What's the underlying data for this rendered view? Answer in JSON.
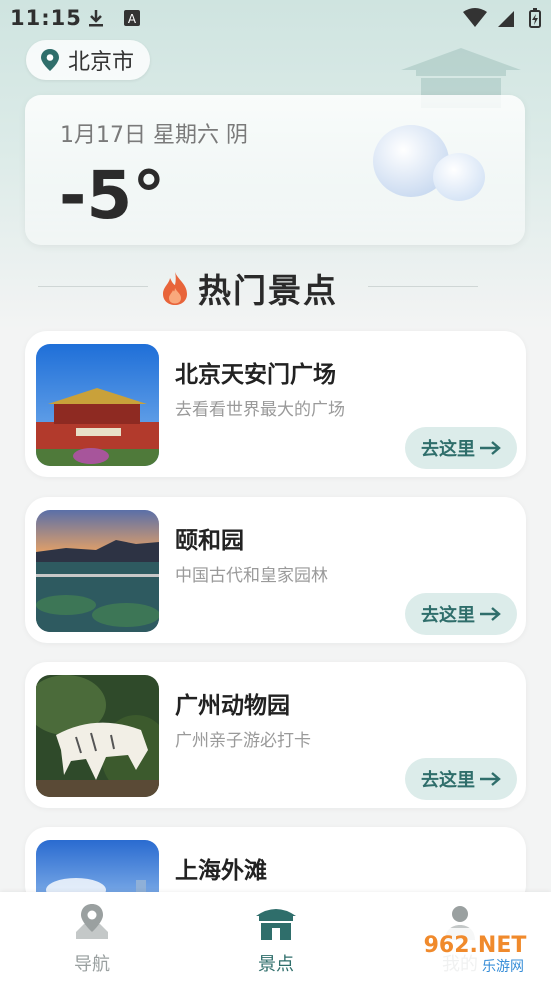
{
  "status_bar": {
    "time": "11:15",
    "left_icons": [
      "download-icon",
      "a-badge-icon"
    ],
    "right_icons": [
      "wifi-icon",
      "signal-icon",
      "battery-icon"
    ]
  },
  "location": {
    "city": "北京市",
    "icon": "location-pin-icon"
  },
  "weather": {
    "date_text": "1月17日 星期六 阴",
    "temperature": "-5°",
    "icon": "cloud-icon"
  },
  "section": {
    "title": "热门景点",
    "icon": "fire-icon",
    "accent": "#e8643a"
  },
  "spots": [
    {
      "name": "北京天安门广场",
      "desc": "去看看世界最大的广场",
      "button": "去这里"
    },
    {
      "name": "颐和园",
      "desc": "中国古代和皇家园林",
      "button": "去这里"
    },
    {
      "name": "广州动物园",
      "desc": "广州亲子游必打卡",
      "button": "去这里"
    },
    {
      "name": "上海外滩",
      "desc": "",
      "button": ""
    }
  ],
  "tabs": [
    {
      "label": "导航",
      "icon": "map-pin-icon",
      "active": false
    },
    {
      "label": "景点",
      "icon": "pavilion-icon",
      "active": true
    },
    {
      "label": "我的",
      "icon": "user-icon",
      "active": false
    }
  ],
  "colors": {
    "primary": "#2f6e6b",
    "button_bg": "#dcecea",
    "inactive": "#9aa0a0"
  },
  "watermark": {
    "text": "962.NET",
    "subtext": "乐游网"
  }
}
